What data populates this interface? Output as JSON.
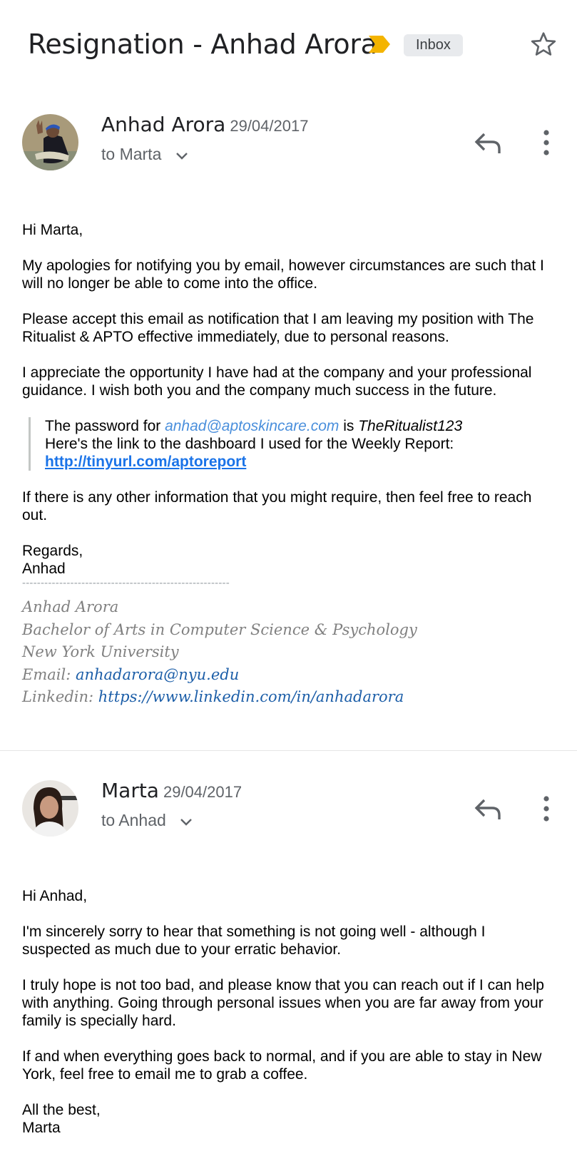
{
  "thread": {
    "subject": "Resignation - Anhad Arora",
    "label": "Inbox"
  },
  "messages": [
    {
      "sender": "Anhad Arora",
      "date": "29/04/2017",
      "recipient": "to Marta",
      "greeting": "Hi Marta,",
      "para1": "My apologies for notifying you by email, however circumstances are such that I will no longer be able to come into the office.",
      "para2": "Please accept this email as notification that I am leaving my position with The Ritualist & APTO effective immediately, due to personal reasons.",
      "para3": "I appreciate the opportunity I have had at the company and your professional guidance. I wish both you and the company much success in the future.",
      "quote": {
        "line1_prefix": "The password for ",
        "line1_email": "anhad@aptoskincare.com",
        "line1_mid": " is ",
        "line1_password": "TheRitualist123",
        "line2": "Here's the link to the dashboard I used for the Weekly Report:",
        "link": "http://tinyurl.com/aptoreport"
      },
      "para4": "If there is any other information that you might require, then feel free to reach out.",
      "closing": "Regards,",
      "closing_name": "Anhad",
      "separator": "--------------------------------------------------------",
      "signature": {
        "name": "Anhad Arora",
        "degree": "Bachelor of Arts in Computer Science & Psychology",
        "school": "New York University",
        "email_label": "Email: ",
        "email": "anhadarora@nyu.edu",
        "linkedin_label": "Linkedin: ",
        "linkedin": "https://www.linkedin.com/in/anhadarora"
      }
    },
    {
      "sender": "Marta",
      "date": "29/04/2017",
      "recipient": "to Anhad",
      "greeting": "Hi Anhad,",
      "para1": "I'm sincerely sorry to hear that something is not going well - although I suspected as much due to your erratic behavior.",
      "para2": "I truly hope is not too bad, and please know that you can reach out if I can help with anything. Going through personal issues when you are far away from your family is specially hard.",
      "para3": "If and when everything goes back to normal, and if you are able to stay in New York, feel free to email me to grab a coffee.",
      "closing": "All the best,",
      "closing_name": "Marta"
    }
  ],
  "colors": {
    "importance_marker": "#f4b400",
    "link": "#1a73e8",
    "signature_text": "#808080"
  },
  "icons": {
    "importance": "importance-marker-icon",
    "star": "star-icon",
    "reply": "reply-icon",
    "more": "more-vert-icon",
    "expand": "chevron-down-icon"
  }
}
